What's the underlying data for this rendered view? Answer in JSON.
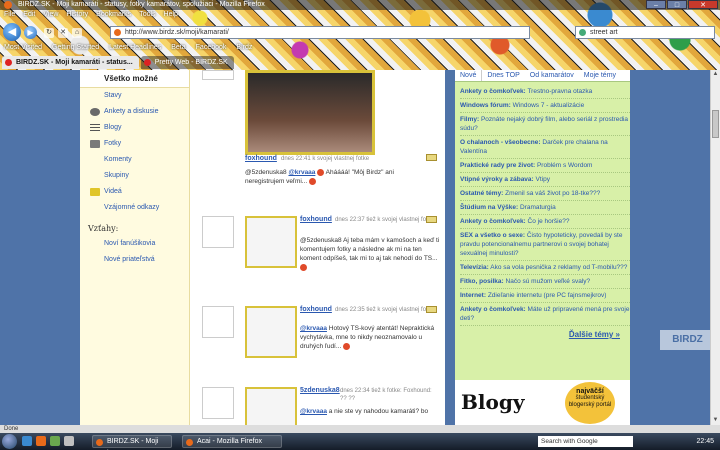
{
  "window": {
    "title": "BIRDZ.SK - Moji kamaráti - statusy, fotky kamarátov, spolužiaci - Mozilla Firefox",
    "controls": [
      "–",
      "□",
      "✕"
    ]
  },
  "menu": [
    "File",
    "Edit",
    "View",
    "History",
    "Bookmarks",
    "Tools",
    "Help"
  ],
  "navigation": {
    "url": "http://www.birdz.sk/moji/kamarati/",
    "search_value": "street art"
  },
  "bookmarks": [
    "Most Visited",
    "Getting Started",
    "Latest Headlines",
    "Beta",
    "Facebook",
    "Birdz"
  ],
  "tabs": [
    {
      "label": "BIRDZ.SK - Moji kamaráti - status...",
      "active": true
    },
    {
      "label": "Pretty Web - BIRDZ.SK",
      "active": false
    }
  ],
  "left_nav": {
    "header": "Všetko možné",
    "items": [
      {
        "label": "Stavy",
        "icon": ""
      },
      {
        "label": "Ankety a diskusie",
        "icon": "speech-bubble-icon"
      },
      {
        "label": "Blogy",
        "icon": "lines-icon"
      },
      {
        "label": "Fotky",
        "icon": "photo-icon"
      },
      {
        "label": "Komenty",
        "icon": ""
      },
      {
        "label": "Skupiny",
        "icon": ""
      },
      {
        "label": "Videá",
        "icon": "video-icon"
      },
      {
        "label": "Vzájomné odkazy",
        "icon": ""
      }
    ],
    "section": "Vzťahy:",
    "relations": [
      "Noví fanúšikovia",
      "Nové priateľstvá"
    ]
  },
  "feed": [
    {
      "author": "foxhound",
      "meta": "dnes 22:41 k svojej vlastnej fotke",
      "comment_prefix": "@5zdenuska8 ",
      "mention": "@krvaaa",
      "comment": " Aháááá! \"Môj Birdz\" ani neregistrujem veľmi..."
    },
    {
      "author": "foxhound",
      "meta": "dnes 22:37 tiež k svojej vlastnej fotke",
      "comment_prefix": "",
      "mention": "",
      "comment": "@5zdenuska8 Aj teba mám v kamošoch a keď ti komentujem fotky a následne ak mi na ten koment odpíšeš, tak mi to aj tak nehodí do TS..."
    },
    {
      "author": "foxhound",
      "meta": "dnes 22:35 tiež k svojej vlastnej fotke",
      "comment_prefix": "",
      "mention": "@krvaaa",
      "comment": " Hotový TS-kový atentát! Nepraktická vychytávka, mne to nikdy neoznamovalo u druhých ľudí..."
    },
    {
      "author": "5zdenuska8",
      "meta": "dnes 22:34 tiež k fotke: Foxhound: ?? ??",
      "comment_prefix": "",
      "mention": "@krvaaa",
      "comment": " a nie ste vy nahodou kamaráti? bo"
    }
  ],
  "right_panel": {
    "tabs": [
      "Nové",
      "Dnes TOP",
      "Od kamarátov",
      "Moje témy"
    ],
    "topics": [
      {
        "forum": "Ankety o čomkoľvek:",
        "title": "Trestno-pravna otazka"
      },
      {
        "forum": "Windows fórum:",
        "title": "Windows 7 - aktualizácie"
      },
      {
        "forum": "Filmy:",
        "title": "Poznáte nejaký dobrý film, alebo seriál z prostredia súdu?"
      },
      {
        "forum": "O chalanoch - všeobecne:",
        "title": "Darček pre chalana na Valentína"
      },
      {
        "forum": "Praktické rady pre život:",
        "title": "Problém s Wordom"
      },
      {
        "forum": "Vtipné výroky a zábava:",
        "title": "Vtipy"
      },
      {
        "forum": "Ostatné témy:",
        "title": "Zmenil sa váš život po 18-tke???"
      },
      {
        "forum": "Štúdium na Výške:",
        "title": "Dramaturgia"
      },
      {
        "forum": "Ankety o čomkoľvek:",
        "title": "Čo je horšie??"
      },
      {
        "forum": "SEX a všetko o sexe:",
        "title": "Čisto hypoteticky, povedali by ste pravdu potencionalnemu partnerovi o svojej bohatej sexuálnej minulosti?"
      },
      {
        "forum": "Televízia:",
        "title": "Ako sa vola pesnička z reklamy od T-mobilu???"
      },
      {
        "forum": "Fitko, posilka:",
        "title": "Načo sú mužom veľké svaly?"
      },
      {
        "forum": "Internet:",
        "title": "Zdieľanie internetu (pre PC fajnsmejkrov)"
      },
      {
        "forum": "Ankety o čomkoľvek:",
        "title": "Máte už pripravené mená pre svoje deti?"
      }
    ],
    "more": "Ďalšie témy »",
    "blogy_title": "Blogy",
    "badge_top": "najväčší",
    "badge_text": "študentský blogerský portál"
  },
  "watermark": "BIRDZ",
  "status": "Done",
  "taskbar": {
    "tasks": [
      "BIRDZ.SK - Moji ka...",
      "Acai - Mozilla Firefox"
    ],
    "search_placeholder": "Search with Google",
    "clock": "22:45"
  }
}
